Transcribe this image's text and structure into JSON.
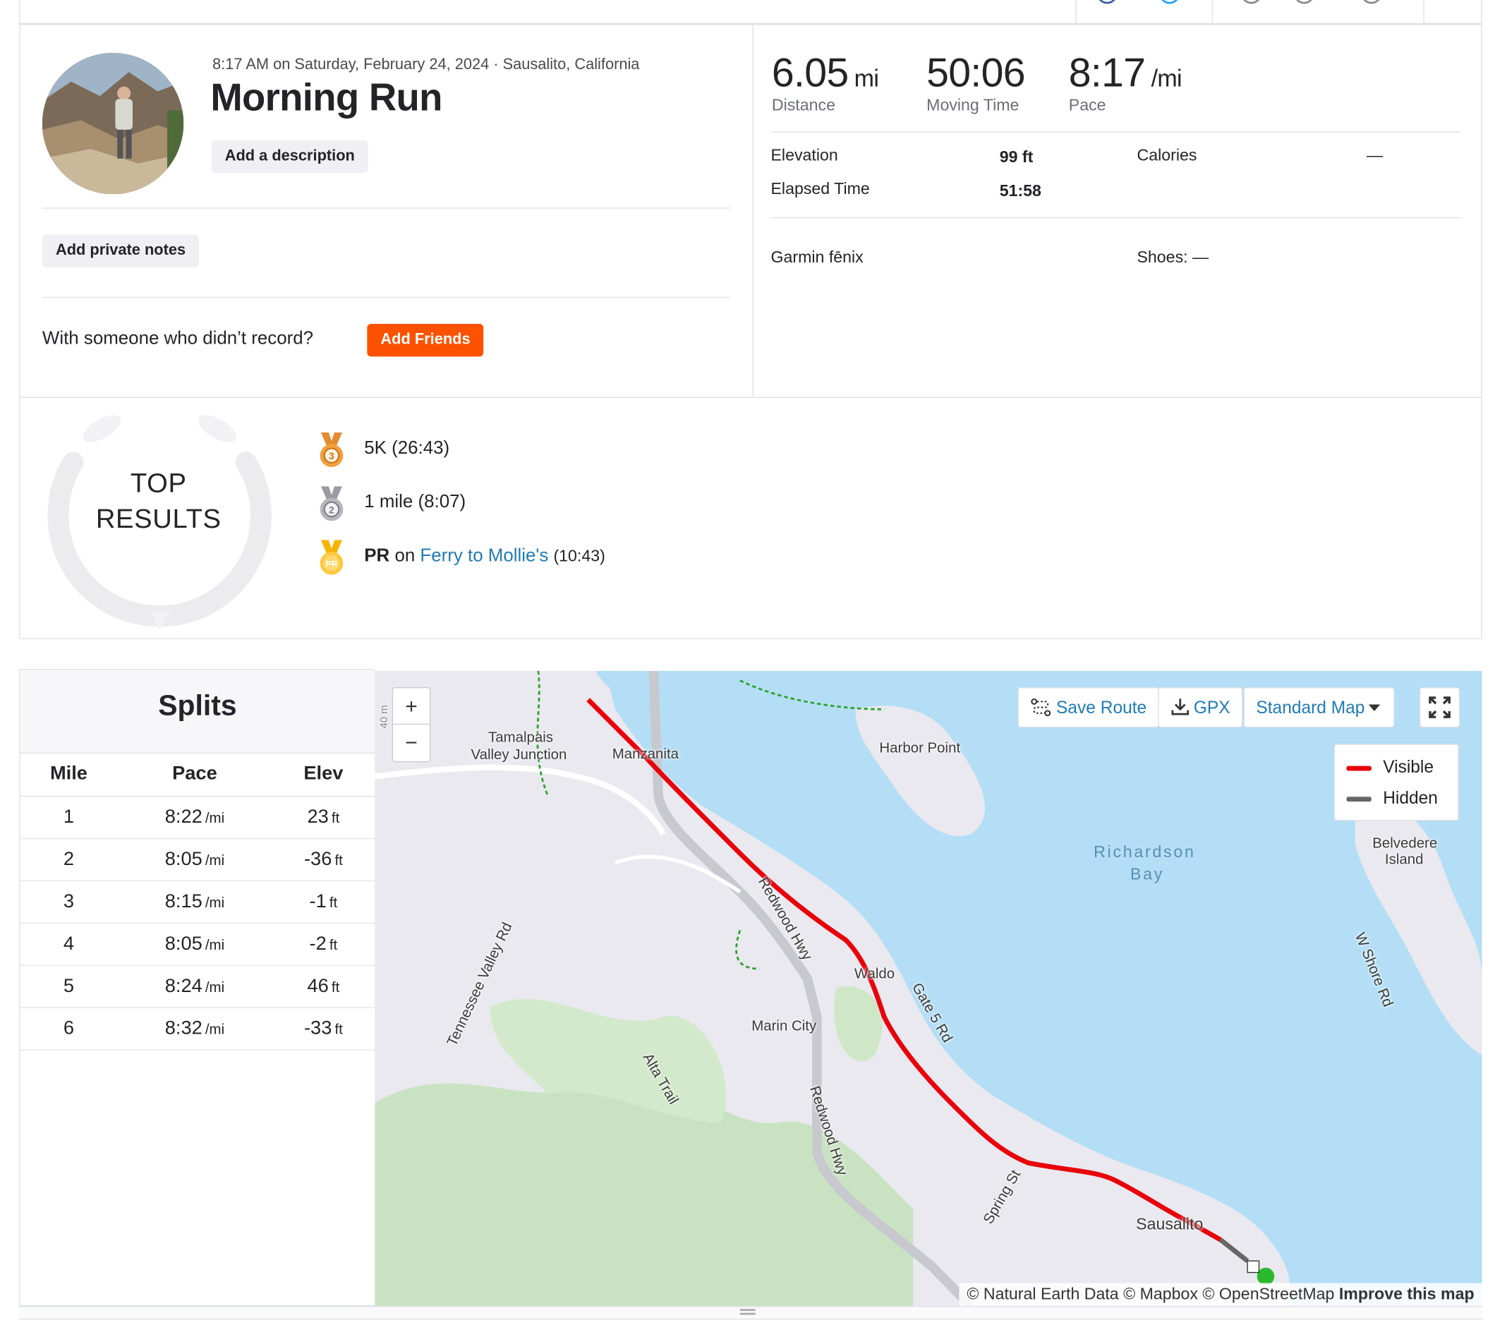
{
  "activity": {
    "meta": "8:17 AM on Saturday, February 24, 2024 · Sausalito, California",
    "title": "Morning Run",
    "add_description": "Add a description",
    "add_private_notes": "Add private notes",
    "with_someone": "With someone who didn’t record?",
    "add_friends": "Add Friends"
  },
  "stats": {
    "distance_value": "6.05",
    "distance_unit": "mi",
    "distance_label": "Distance",
    "moving_time_value": "50:06",
    "moving_time_label": "Moving Time",
    "pace_value": "8:17",
    "pace_unit": "/mi",
    "pace_label": "Pace",
    "elevation_label": "Elevation",
    "elevation_value": "99 ft",
    "elapsed_label": "Elapsed Time",
    "elapsed_value": "51:58",
    "calories_label": "Calories",
    "calories_value": "—",
    "device": "Garmin fēnix",
    "shoes": "Shoes: —"
  },
  "top_results": {
    "heading": "TOP RESULTS",
    "items": [
      {
        "medal": "3",
        "text": "5K (26:43)"
      },
      {
        "medal": "2",
        "text": "1 mile (8:07)"
      },
      {
        "medal": "PR",
        "pr": "PR",
        "on": "on",
        "link": "Ferry to Mollie's",
        "time": "(10:43)"
      }
    ]
  },
  "splits": {
    "heading": "Splits",
    "columns": [
      "Mile",
      "Pace",
      "Elev"
    ],
    "rows": [
      {
        "mile": "1",
        "pace": "8:22",
        "pace_unit": "/mi",
        "elev": "23",
        "elev_unit": "ft"
      },
      {
        "mile": "2",
        "pace": "8:05",
        "pace_unit": "/mi",
        "elev": "-36",
        "elev_unit": "ft"
      },
      {
        "mile": "3",
        "pace": "8:15",
        "pace_unit": "/mi",
        "elev": "-1",
        "elev_unit": "ft"
      },
      {
        "mile": "4",
        "pace": "8:05",
        "pace_unit": "/mi",
        "elev": "-2",
        "elev_unit": "ft"
      },
      {
        "mile": "5",
        "pace": "8:24",
        "pace_unit": "/mi",
        "elev": "46",
        "elev_unit": "ft"
      },
      {
        "mile": "6",
        "pace": "8:32",
        "pace_unit": "/mi",
        "elev": "-33",
        "elev_unit": "ft"
      }
    ]
  },
  "map": {
    "zoom_in": "+",
    "zoom_out": "−",
    "scale_hint": "40 m",
    "save_route": "Save Route",
    "gpx": "GPX",
    "map_style": "Standard Map",
    "legend_visible": "Visible",
    "legend_hidden": "Hidden",
    "attribution": "© Natural Earth Data © Mapbox © OpenStreetMap",
    "improve": "Improve this map",
    "labels": {
      "tamalpais": "Tamalpais",
      "valley_junction": "Valley Junction",
      "manzanita": "Manzanita",
      "harbor_point": "Harbor Point",
      "richardson": "Richardson",
      "bay": "Bay",
      "belvedere": "Belvedere",
      "island": "Island",
      "w_shore_rd": "W Shore Rd",
      "redwood_hwy_1": "Redwood Hwy",
      "redwood_hwy_2": "Redwood Hwy",
      "waldo": "Waldo",
      "gate5": "Gate 5 Rd",
      "marin_city": "Marin City",
      "tennessee": "Tennessee Valley Rd",
      "alta": "Alta Trail",
      "spring": "Spring St",
      "sausalito": "Sausalito"
    }
  },
  "colors": {
    "brand_orange": "#fc5200",
    "route_visible": "#e8000b",
    "route_hidden": "#666666",
    "link_blue": "#1f7bb6",
    "water": "#b3def5"
  }
}
